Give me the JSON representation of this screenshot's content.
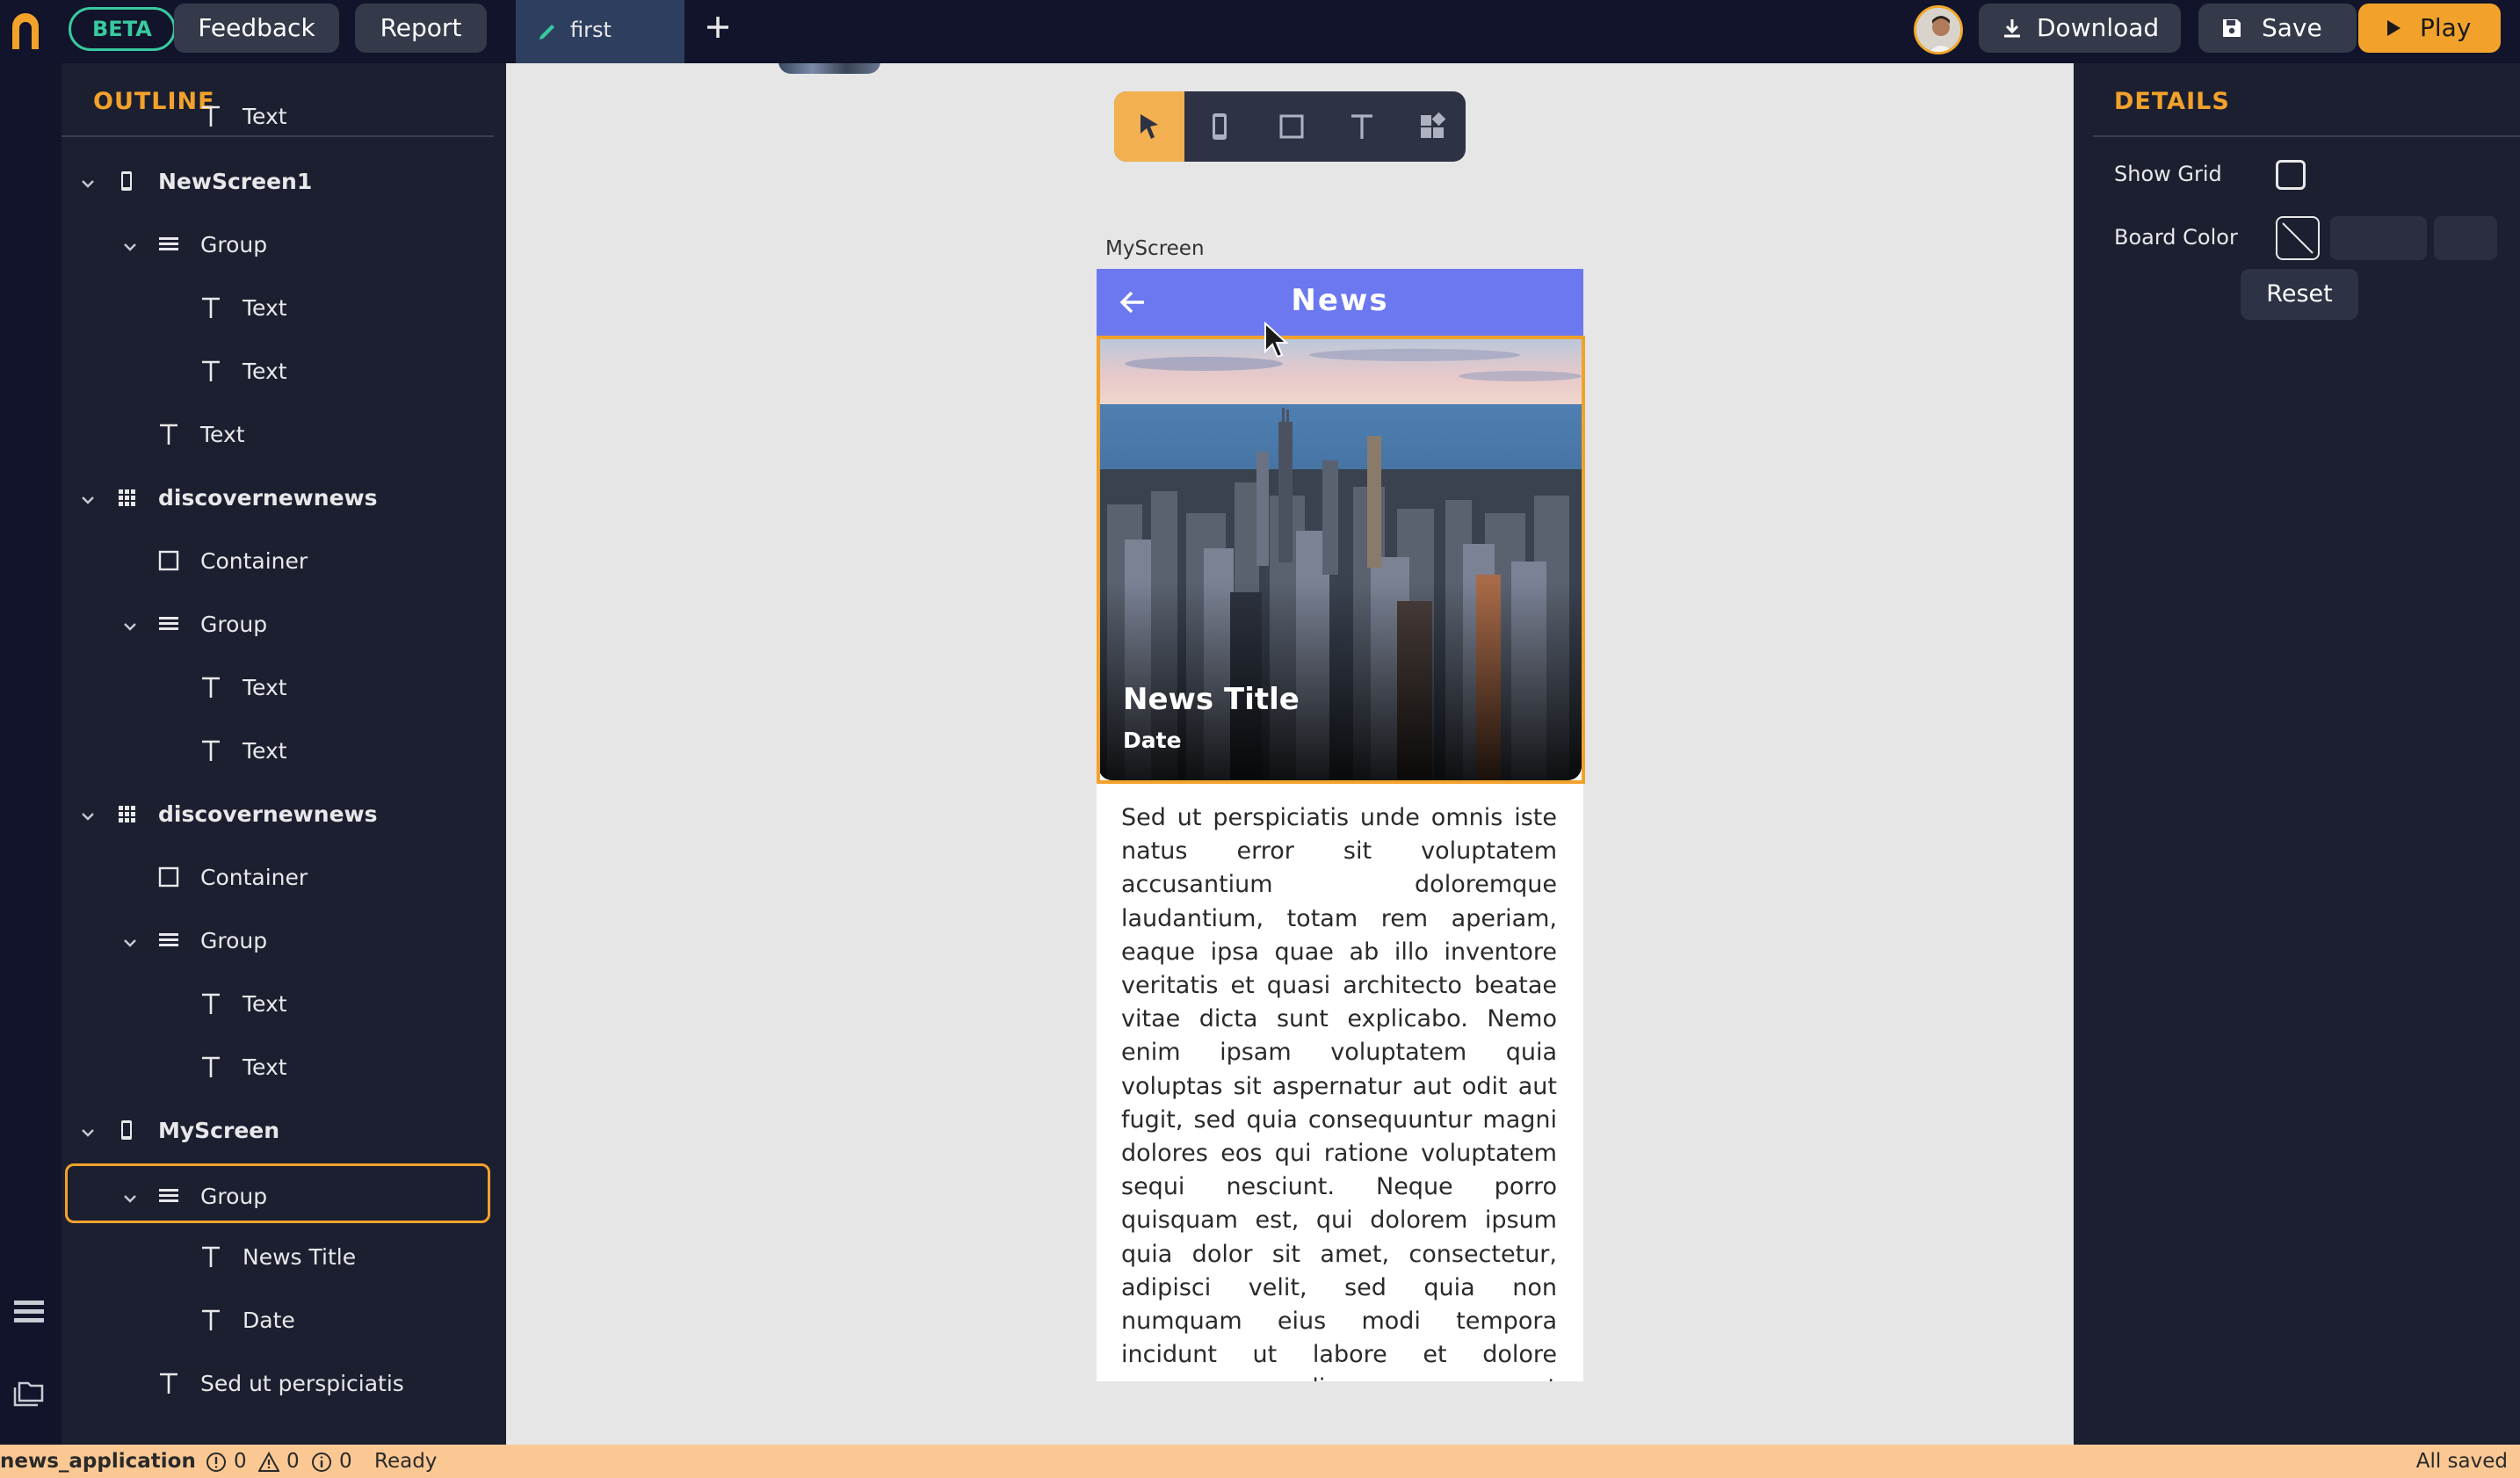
{
  "topbar": {
    "beta_label": "BETA",
    "feedback_label": "Feedback",
    "report_label": "Report",
    "tab_label": "first",
    "download_label": "Download",
    "save_label": "Save",
    "play_label": "Play"
  },
  "outline": {
    "title": "OUTLINE",
    "items": [
      {
        "label": "Text",
        "icon": "text-icon"
      },
      {
        "label": "NewScreen1",
        "icon": "phone-icon"
      },
      {
        "label": "Group",
        "icon": "group-icon"
      },
      {
        "label": "Text",
        "icon": "text-icon"
      },
      {
        "label": "Text",
        "icon": "text-icon"
      },
      {
        "label": "Text",
        "icon": "text-icon"
      },
      {
        "label": "discovernewnews",
        "icon": "grid-icon"
      },
      {
        "label": "Container",
        "icon": "container-icon"
      },
      {
        "label": "Group",
        "icon": "group-icon"
      },
      {
        "label": "Text",
        "icon": "text-icon"
      },
      {
        "label": "Text",
        "icon": "text-icon"
      },
      {
        "label": "discovernewnews",
        "icon": "grid-icon"
      },
      {
        "label": "Container",
        "icon": "container-icon"
      },
      {
        "label": "Group",
        "icon": "group-icon"
      },
      {
        "label": "Text",
        "icon": "text-icon"
      },
      {
        "label": "Text",
        "icon": "text-icon"
      },
      {
        "label": "MyScreen",
        "icon": "phone-icon"
      },
      {
        "label": "Group",
        "icon": "group-icon"
      },
      {
        "label": "News Title",
        "icon": "text-icon"
      },
      {
        "label": "Date",
        "icon": "text-icon"
      },
      {
        "label": "Sed ut perspiciatis",
        "icon": "text-icon"
      }
    ],
    "selected_index": 17
  },
  "canvas": {
    "screen_label": "MyScreen",
    "tools": [
      "select-tool-icon",
      "phone-tool-icon",
      "container-tool-icon",
      "text-tool-icon",
      "widgets-tool-icon"
    ],
    "active_tool": "select-tool-icon",
    "phone": {
      "appbar_title": "News",
      "appbar_color": "#6b78f0",
      "hero_title": "News Title",
      "hero_date": "Date",
      "body": "Sed ut perspiciatis unde omnis iste natus error sit voluptatem accusantium doloremque laudantium, totam rem aperiam, eaque ipsa quae ab illo inventore veritatis et quasi architecto beatae vitae dicta sunt explicabo. Nemo enim ipsam voluptatem quia voluptas sit aspernatur aut odit aut fugit, sed quia consequuntur magni dolores eos qui ratione voluptatem sequi nesciunt. Neque porro quisquam est, qui dolorem ipsum quia dolor sit amet, consectetur, adipisci velit, sed quia non numquam eius modi tempora incidunt ut labore et dolore magnam aliquam quaerat voluptatem. Ut enim ad"
    }
  },
  "details": {
    "title": "DETAILS",
    "show_grid_label": "Show Grid",
    "show_grid_checked": false,
    "board_color_label": "Board Color",
    "reset_label": "Reset"
  },
  "statusbar": {
    "project_name": "news_application",
    "errors": "0",
    "warnings": "0",
    "infos": "0",
    "state": "Ready",
    "save_state": "All saved"
  },
  "colors": {
    "accent": "#f2a22b",
    "beta": "#38c9a0",
    "topbar_bg": "#11142a",
    "panel_bg": "#1c1f30",
    "statusbar_bg": "#fbc894"
  }
}
